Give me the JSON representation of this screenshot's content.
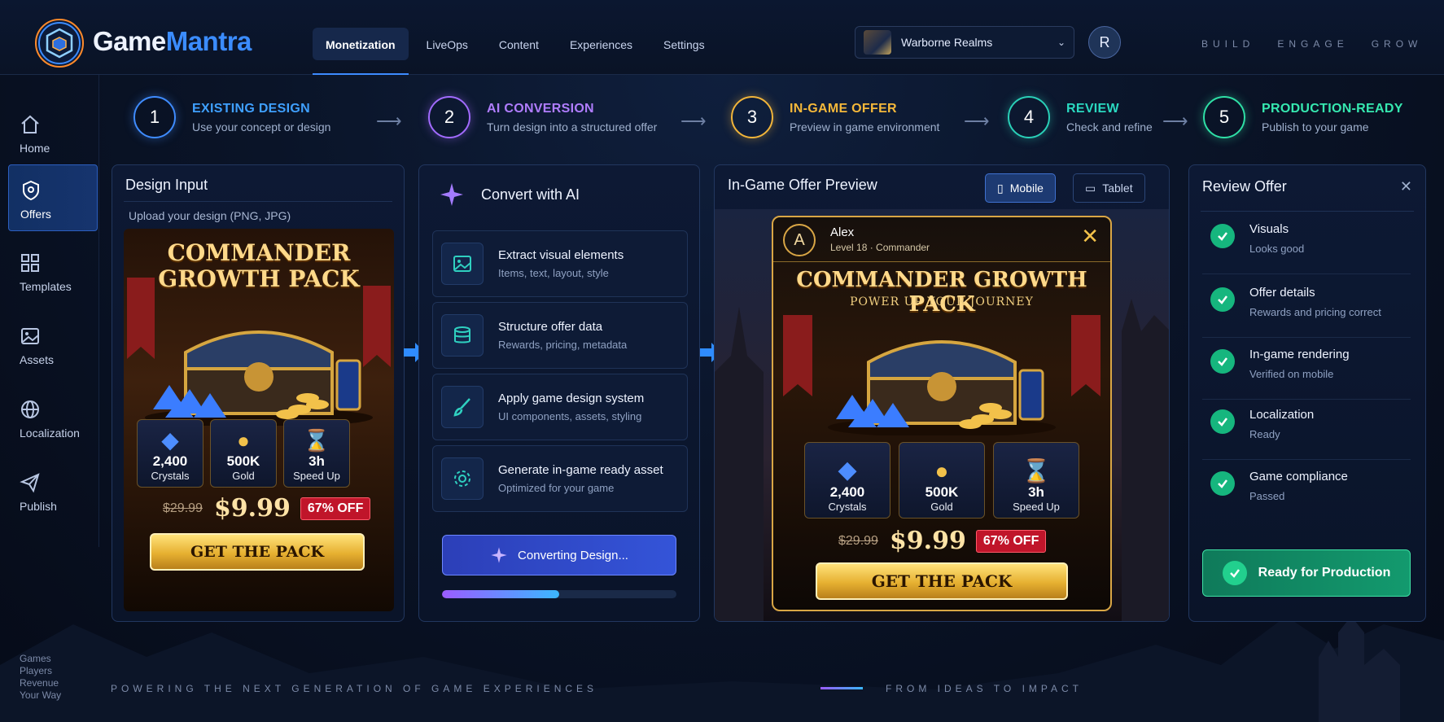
{
  "header": {
    "logo": {
      "part1": "Game",
      "part2": "Mantra"
    },
    "nav": [
      {
        "label": "Monetization",
        "active": true
      },
      {
        "label": "LiveOps"
      },
      {
        "label": "Content"
      },
      {
        "label": "Experiences"
      },
      {
        "label": "Settings"
      }
    ],
    "game_selector": {
      "value": "Warborne Realms"
    },
    "avatar_initial": "R",
    "tagline": "BUILD   ENGAGE   GROW"
  },
  "sidebar": [
    {
      "label": "Home",
      "icon": "home-icon"
    },
    {
      "label": "Offers",
      "icon": "shield-icon",
      "active": true
    },
    {
      "label": "Templates",
      "icon": "grid-icon"
    },
    {
      "label": "Assets",
      "icon": "image-icon"
    },
    {
      "label": "Localization",
      "icon": "globe-icon"
    },
    {
      "label": "Publish",
      "icon": "send-icon"
    }
  ],
  "steps": [
    {
      "num": "1",
      "title": "EXISTING DESIGN",
      "sub": "Use your concept or design",
      "color": "#3f8cff"
    },
    {
      "num": "2",
      "title": "AI CONVERSION",
      "sub": "Turn design into a structured offer",
      "color": "#a26bff"
    },
    {
      "num": "3",
      "title": "IN-GAME OFFER",
      "sub": "Preview in game environment",
      "color": "#f2b53a"
    },
    {
      "num": "4",
      "title": "REVIEW",
      "sub": "Check and refine",
      "color": "#2ad0b8"
    },
    {
      "num": "5",
      "title": "PRODUCTION-READY",
      "sub": "Publish to your game",
      "color": "#2fe0a6"
    }
  ],
  "design_input": {
    "title": "Design Input",
    "upload_hint": "Upload your design (PNG, JPG)",
    "offer_title_line1": "COMMANDER",
    "offer_title_line2": "GROWTH PACK"
  },
  "offer": {
    "title": "COMMANDER GROWTH PACK",
    "subtitle": "POWER UP YOUR JOURNEY",
    "rewards": [
      {
        "value": "2,400",
        "label": "Crystals"
      },
      {
        "value": "500K",
        "label": "Gold"
      },
      {
        "value": "3h",
        "label": "Speed Up"
      }
    ],
    "old_price": "$29.99",
    "price": "$9.99",
    "discount": "67% OFF",
    "cta": "GET THE PACK"
  },
  "convert": {
    "title": "Convert with AI",
    "steps": [
      {
        "title": "Extract visual elements",
        "sub": "Items, text, layout, style",
        "icon": "image-icon"
      },
      {
        "title": "Structure offer data",
        "sub": "Rewards, pricing, metadata",
        "icon": "database-icon"
      },
      {
        "title": "Apply game design system",
        "sub": "UI components, assets, styling",
        "icon": "brush-icon"
      },
      {
        "title": "Generate in-game ready asset",
        "sub": "Optimized for your game",
        "icon": "gear-icon"
      }
    ],
    "button": "Converting Design...",
    "progress": 0.5
  },
  "preview": {
    "title": "In-Game Offer Preview",
    "devices": [
      {
        "label": "Mobile",
        "active": true
      },
      {
        "label": "Tablet"
      }
    ],
    "player": {
      "initial": "A",
      "name": "Alex",
      "level": "Level 18 · Commander"
    }
  },
  "review": {
    "title": "Review Offer",
    "items": [
      {
        "title": "Visuals",
        "sub": "Looks good"
      },
      {
        "title": "Offer details",
        "sub": "Rewards and pricing correct"
      },
      {
        "title": "In-game rendering",
        "sub": "Verified on mobile"
      },
      {
        "title": "Localization",
        "sub": "Ready"
      },
      {
        "title": "Game compliance",
        "sub": "Passed"
      }
    ],
    "button": "Ready for Production"
  },
  "footer": {
    "left": "POWERING THE NEXT GENERATION OF GAME EXPERIENCES",
    "right": "FROM IDEAS TO IMPACT",
    "small": [
      "Games",
      "Players",
      "Revenue",
      "Your Way"
    ]
  }
}
